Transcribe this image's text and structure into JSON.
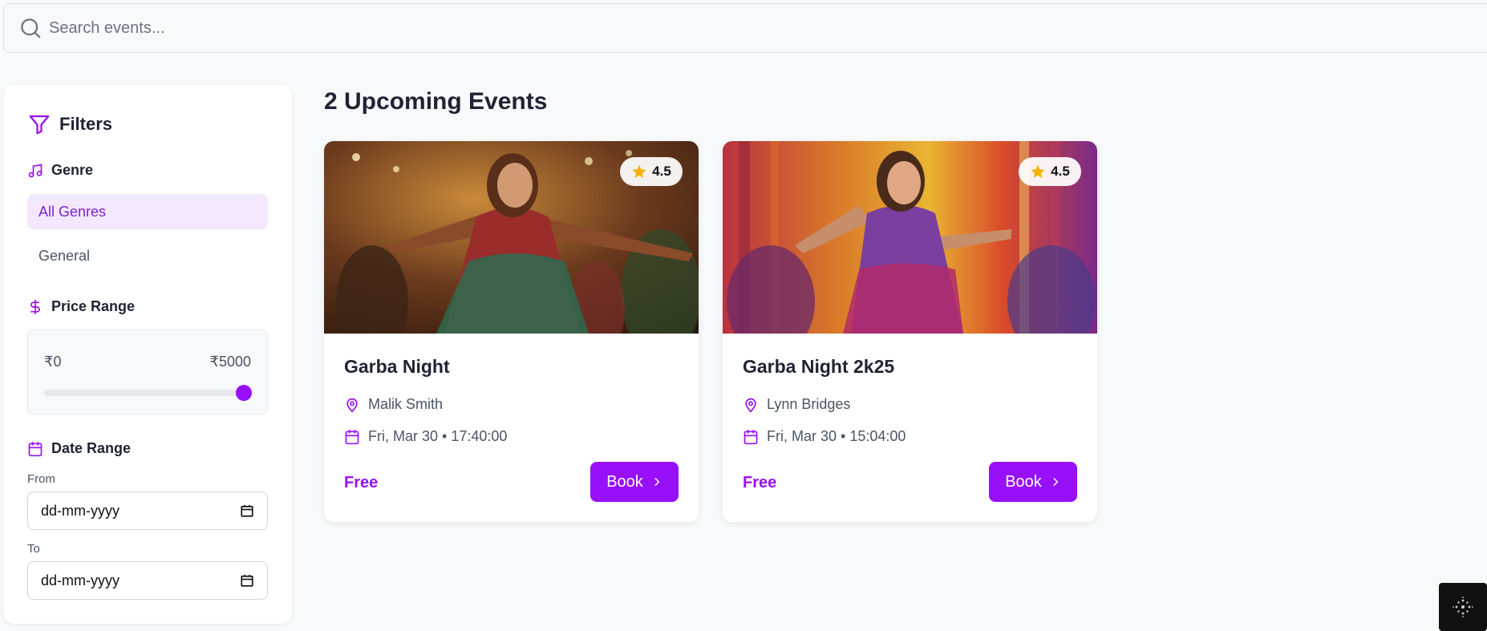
{
  "search": {
    "placeholder": "Search events..."
  },
  "sidebar": {
    "title": "Filters",
    "genre": {
      "heading": "Genre",
      "items": [
        {
          "label": "All Genres",
          "active": true
        },
        {
          "label": "General",
          "active": false
        }
      ]
    },
    "price": {
      "heading": "Price Range",
      "min_label": "₹0",
      "max_label": "₹5000",
      "slider_value_fraction": 1.0
    },
    "date": {
      "heading": "Date Range",
      "from_label": "From",
      "from_value": "dd-mm-yyyy",
      "to_label": "To",
      "to_value": "dd-mm-yyyy"
    }
  },
  "main": {
    "title": "2 Upcoming Events",
    "events": [
      {
        "title": "Garba Night",
        "rating": "4.5",
        "organizer": "Malik Smith",
        "datetime": "Fri, Mar 30 • 17:40:00",
        "price": "Free",
        "book_label": "Book"
      },
      {
        "title": "Garba Night 2k25",
        "rating": "4.5",
        "organizer": "Lynn Bridges",
        "datetime": "Fri, Mar 30 • 15:04:00",
        "price": "Free",
        "book_label": "Book"
      }
    ]
  },
  "colors": {
    "accent": "#9810fa",
    "accent_light": "#f3e8ff",
    "star": "#f5b301"
  }
}
